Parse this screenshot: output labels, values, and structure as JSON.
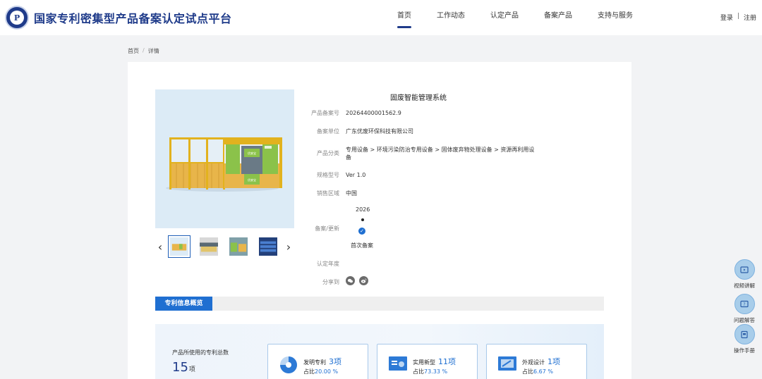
{
  "header": {
    "logo_text": "P",
    "site_title": "国家专利密集型产品备案认定试点平台",
    "nav": [
      "首页",
      "工作动态",
      "认定产品",
      "备案产品",
      "支持与服务"
    ],
    "login": "登录",
    "separator": "|",
    "register": "注册"
  },
  "breadcrumb": {
    "home": "首页",
    "sep": "/",
    "current": "详情"
  },
  "product": {
    "name": "固废智能管理系统",
    "fields": [
      {
        "label": "产品备案号",
        "value": "20264400001562.9"
      },
      {
        "label": "备案单位",
        "value": "广东优废环保科技有限公司"
      },
      {
        "label": "产品分类",
        "value": "专用设备 > 环境污染防治专用设备 > 固体废弃物处理设备 > 资源再利用设备"
      },
      {
        "label": "规格型号",
        "value": "Ver 1.0"
      },
      {
        "label": "销售区域",
        "value": "中国"
      },
      {
        "label": "备案/更新",
        "value": ""
      },
      {
        "label": "认定年度",
        "value": ""
      },
      {
        "label": "分享到",
        "value": ""
      }
    ],
    "timeline_year": "2026",
    "timeline_event": "首次备案",
    "device_screen_label": "优废宝",
    "device_panel_label": "优废宝"
  },
  "gallery": {
    "prev": "‹",
    "next": "›",
    "thumbs": [
      "thumb-1",
      "thumb-2",
      "thumb-3",
      "thumb-4"
    ]
  },
  "share": {
    "icons": [
      "wechat-icon",
      "weibo-icon"
    ]
  },
  "patent": {
    "section_title": "专利信息概览",
    "total_label": "产品所使用的专利总数",
    "total_count": "15",
    "total_unit": "项",
    "ratio_label": "占比",
    "stats": [
      {
        "title": "发明专利",
        "count": "3项",
        "ratio": "20.00 %"
      },
      {
        "title": "实用新型",
        "count": "11项",
        "ratio": "73.33 %"
      },
      {
        "title": "外观设计",
        "count": "1项",
        "ratio": "6.67 %"
      }
    ]
  },
  "side": {
    "items": [
      {
        "label": "视频讲解",
        "icon": "video-icon"
      },
      {
        "label": "问题解答",
        "icon": "question-icon"
      },
      {
        "label": "操作手册",
        "icon": "manual-icon"
      }
    ]
  },
  "colors": {
    "brand": "#1f3b8a",
    "accent": "#1f6fd1"
  }
}
